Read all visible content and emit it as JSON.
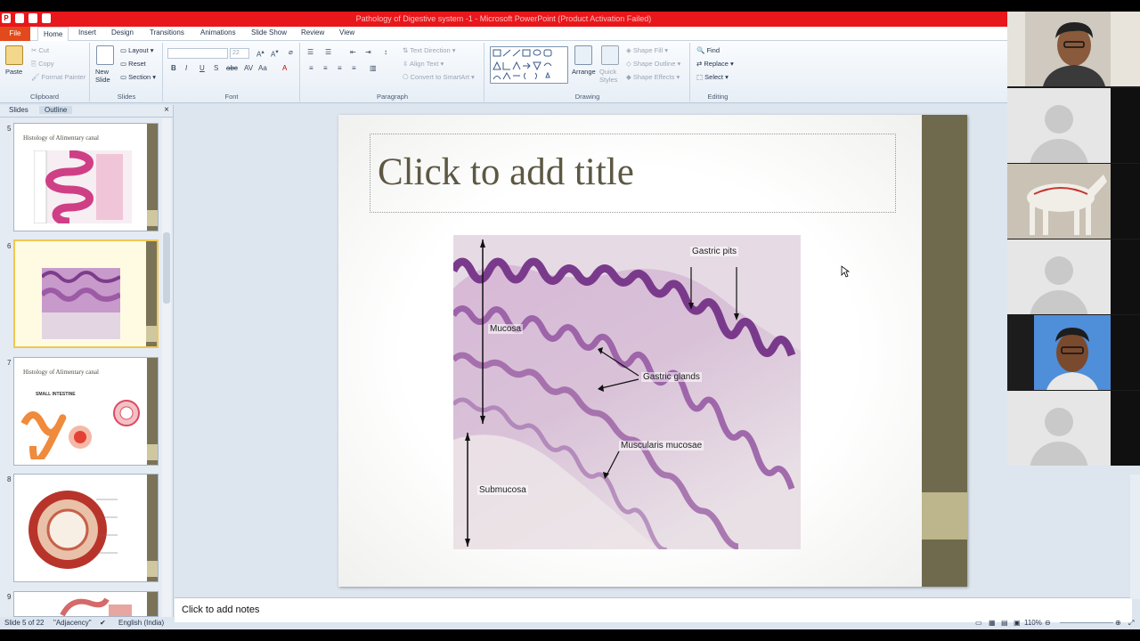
{
  "window": {
    "title": "Pathology of Digestive system -1 - Microsoft PowerPoint (Product Activation Failed)"
  },
  "tabs": [
    "File",
    "Home",
    "Insert",
    "Design",
    "Transitions",
    "Animations",
    "Slide Show",
    "Review",
    "View"
  ],
  "ribbon": {
    "clipboard": {
      "paste": "Paste",
      "cut": "Cut",
      "copy": "Copy",
      "format_painter": "Format Painter",
      "label": "Clipboard"
    },
    "slides": {
      "new_slide": "New Slide",
      "layout": "Layout",
      "reset": "Reset",
      "section": "Section",
      "label": "Slides"
    },
    "font": {
      "font_size": "22",
      "label": "Font"
    },
    "paragraph": {
      "text_direction": "Text Direction",
      "align_text": "Align Text",
      "convert_smartart": "Convert to SmartArt",
      "label": "Paragraph"
    },
    "drawing": {
      "arrange": "Arrange",
      "quick_styles": "Quick Styles",
      "shape_fill": "Shape Fill",
      "shape_outline": "Shape Outline",
      "shape_effects": "Shape Effects",
      "label": "Drawing"
    },
    "editing": {
      "find": "Find",
      "replace": "Replace",
      "select": "Select",
      "label": "Editing"
    }
  },
  "slides_panel": {
    "tab_slides": "Slides",
    "tab_outline": "Outline",
    "thumbnails": [
      {
        "number": "5",
        "title": "Histology of Alimentary canal",
        "sub": ""
      },
      {
        "number": "6",
        "title": "",
        "sub": ""
      },
      {
        "number": "7",
        "title": "Histology of Alimentary canal",
        "sub": "SMALL INTESTINE"
      },
      {
        "number": "8",
        "title": "",
        "sub": ""
      },
      {
        "number": "9",
        "title": "",
        "sub": ""
      }
    ]
  },
  "slide": {
    "title_placeholder": "Click to add title",
    "labels": {
      "gastric_pits": "Gastric pits",
      "mucosa": "Mucosa",
      "gastric_glands": "Gastric glands",
      "muscularis_mucosae": "Muscularis mucosae",
      "submucosa": "Submucosa"
    }
  },
  "notes": {
    "placeholder": "Click to add notes"
  },
  "status": {
    "slide_count": "Slide 5 of 22",
    "theme": "\"Adjacency\"",
    "language": "English (India)",
    "zoom": "110%"
  },
  "colors": {
    "title_bar": "#e8171b",
    "file_tab": "#e24a1b",
    "slide_accent": "#6f6a4d",
    "slide_accent_light": "#bdb58b"
  }
}
